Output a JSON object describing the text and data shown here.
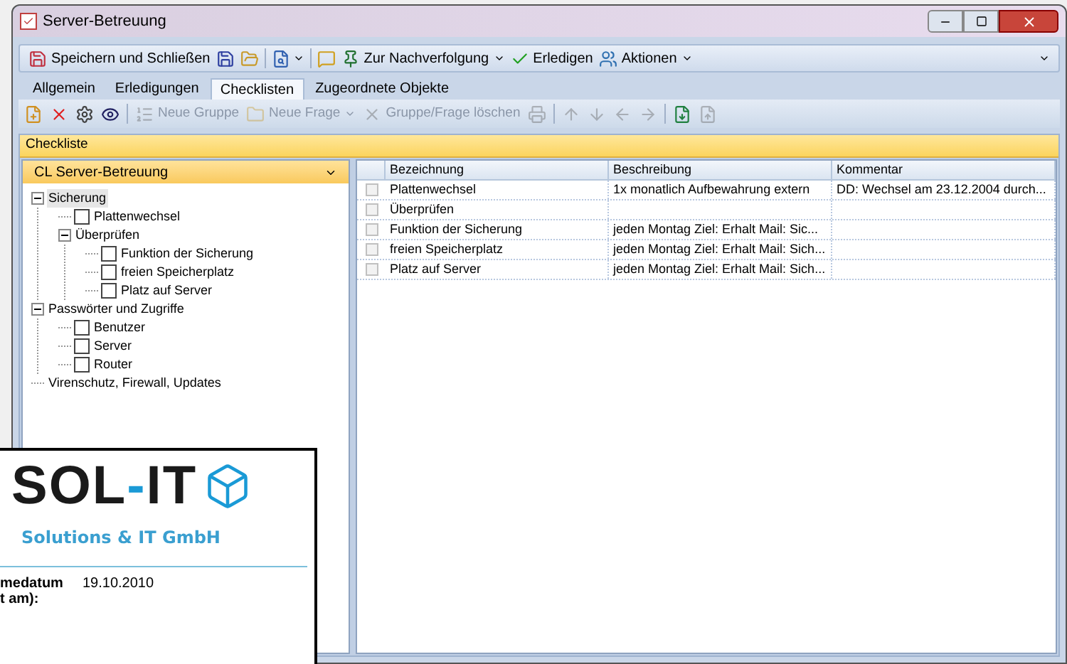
{
  "window": {
    "title": "Server-Betreuung"
  },
  "toolbar": [
    {
      "label": "Speichern und Schließen"
    },
    {
      "label": "Zur Nachverfolgung"
    },
    {
      "label": "Erledigen"
    },
    {
      "label": "Aktionen"
    }
  ],
  "tabs": [
    {
      "label": "Allgemein",
      "selected": false
    },
    {
      "label": "Erledigungen",
      "selected": false
    },
    {
      "label": "Checklisten",
      "selected": true
    },
    {
      "label": "Zugeordnete Objekte",
      "selected": false
    }
  ],
  "subtoolbar": [
    {
      "label": "Neue Gruppe",
      "disabled": true
    },
    {
      "label": "Neue Frage",
      "disabled": true
    },
    {
      "label": "Gruppe/Frage löschen",
      "disabled": true
    }
  ],
  "section": {
    "title": "Checkliste"
  },
  "checklist_select": {
    "value": "CL Server-Betreuung"
  },
  "tree": [
    {
      "kind": "group",
      "label": "Sicherung",
      "selected": true,
      "children": [
        {
          "kind": "question",
          "label": "Plattenwechsel",
          "selected": false,
          "checked": false
        },
        {
          "kind": "group",
          "label": "Überprüfen",
          "selected": false,
          "children": [
            {
              "kind": "question",
              "label": "Funktion der Sicherung",
              "selected": false,
              "checked": false
            },
            {
              "kind": "question",
              "label": "freien Speicherplatz",
              "selected": false,
              "checked": false
            },
            {
              "kind": "question",
              "label": "Platz auf Server",
              "selected": false,
              "checked": false
            }
          ]
        }
      ]
    },
    {
      "kind": "group",
      "label": "Passwörter und Zugriffe",
      "selected": false,
      "children": [
        {
          "kind": "question",
          "label": "Benutzer",
          "selected": false,
          "checked": false
        },
        {
          "kind": "question",
          "label": "Server",
          "selected": false,
          "checked": false
        },
        {
          "kind": "question",
          "label": "Router",
          "selected": false,
          "checked": false
        }
      ]
    },
    {
      "kind": "group",
      "label": "Virenschutz, Firewall, Updates",
      "selected": false
    }
  ],
  "table": {
    "columns": [
      "Bezeichnung",
      "Beschreibung",
      "Kommentar"
    ],
    "rows": [
      {
        "checked": false,
        "cells": [
          "Plattenwechsel",
          "1x monatlich Aufbewahrung extern",
          "DD: Wechsel am 23.12.2004 durch..."
        ]
      },
      {
        "checked": false,
        "cells": [
          "Überprüfen",
          "",
          ""
        ]
      },
      {
        "checked": false,
        "cells": [
          "Funktion der Sicherung",
          "jeden Montag  Ziel: Erhalt Mail: Sic...",
          ""
        ]
      },
      {
        "checked": false,
        "cells": [
          "freien Speicherplatz",
          "jeden Montag Ziel: Erhalt Mail: Sich...",
          ""
        ]
      },
      {
        "checked": false,
        "cells": [
          "Platz auf Server",
          "jeden Montag Ziel: Erhalt Mail: Sich...",
          ""
        ]
      }
    ]
  },
  "document": {
    "logo": {
      "left": "SOL",
      "dash": "-",
      "right": "IT"
    },
    "company": "Solutions & IT GmbH",
    "fields": [
      {
        "label": "medatum",
        "value": "19.10.2010"
      },
      {
        "label": "t am):"
      }
    ]
  }
}
